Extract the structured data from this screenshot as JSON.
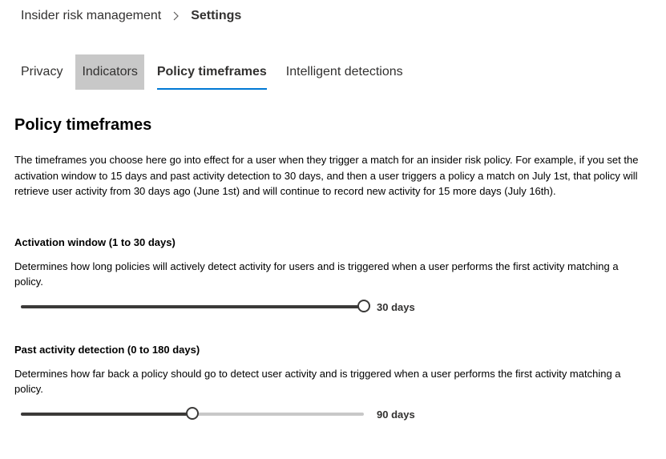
{
  "breadcrumb": {
    "parent": "Insider risk management",
    "current": "Settings"
  },
  "tabs": [
    {
      "label": "Privacy",
      "state": "normal"
    },
    {
      "label": "Indicators",
      "state": "hover"
    },
    {
      "label": "Policy timeframes",
      "state": "active"
    },
    {
      "label": "Intelligent detections",
      "state": "normal"
    }
  ],
  "section": {
    "title": "Policy timeframes",
    "intro": "The timeframes you choose here go into effect for a user when they trigger a match for an insider risk policy. For example, if you set the activation window to 15 days and past activity detection to 30 days, and then a user triggers a policy a match on July 1st, that policy will retrieve user activity from 30 days ago (June 1st) and will continue to record new activity for 15 more days (July 16th)."
  },
  "activation_window": {
    "label": "Activation window (1 to 30 days)",
    "description": "Determines how long policies will actively detect activity for users and is triggered when a user performs the first activity matching a policy.",
    "min": 1,
    "max": 30,
    "value": 30,
    "value_label": "30 days"
  },
  "past_activity": {
    "label": "Past activity detection (0 to 180 days)",
    "description": "Determines how far back a policy should go to detect user activity and is triggered when a user performs the first activity matching a policy.",
    "min": 0,
    "max": 180,
    "value": 90,
    "value_label": "90 days"
  },
  "colors": {
    "accent": "#0078d4",
    "slider_active": "#3b3a39",
    "slider_inactive": "#c8c8c8",
    "tab_hover": "#c8c8c8"
  },
  "icons": {
    "breadcrumb_separator": "chevron-right-icon"
  }
}
